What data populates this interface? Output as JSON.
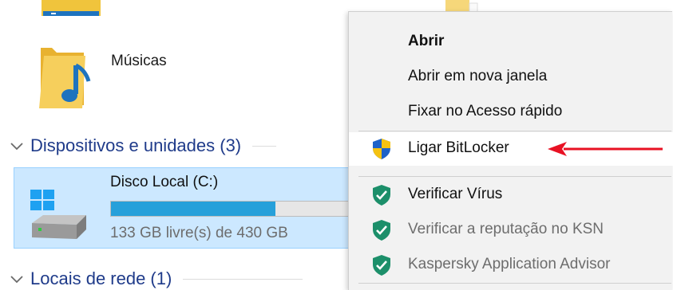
{
  "explorer": {
    "music_folder": {
      "label": "Músicas"
    },
    "devices_group": {
      "header": "Dispositivos e unidades (3)"
    },
    "drive": {
      "name": "Disco Local (C:)",
      "free_text": "133 GB livre(s) de 430 GB",
      "used_fraction": 0.69
    },
    "network_group": {
      "header": "Locais de rede (1)"
    }
  },
  "context_menu": {
    "items": [
      {
        "label": "Abrir"
      },
      {
        "label": "Abrir em nova janela"
      },
      {
        "label": "Fixar no Acesso rápido"
      },
      {
        "label": "Ligar BitLocker"
      },
      {
        "label": "Verificar Vírus"
      },
      {
        "label": "Verificar a reputação no KSN"
      },
      {
        "label": "Kaspersky Application Advisor"
      }
    ]
  },
  "icons": {
    "folder": "folder-icon",
    "music_folder": "music-folder-icon",
    "drive": "windows-drive-icon",
    "bitlocker": "uac-shield-icon",
    "kaspersky": "kaspersky-shield-icon",
    "arrow": "red-arrow"
  },
  "colors": {
    "group_header": "#1f3b8a",
    "selection_bg": "#cce8ff",
    "selection_border": "#99d1ff",
    "drive_bar": "#26a0da",
    "menu_bg": "#f2f2f2",
    "kaspersky_green": "#1c8f6a",
    "annotation_red": "#e81123"
  }
}
